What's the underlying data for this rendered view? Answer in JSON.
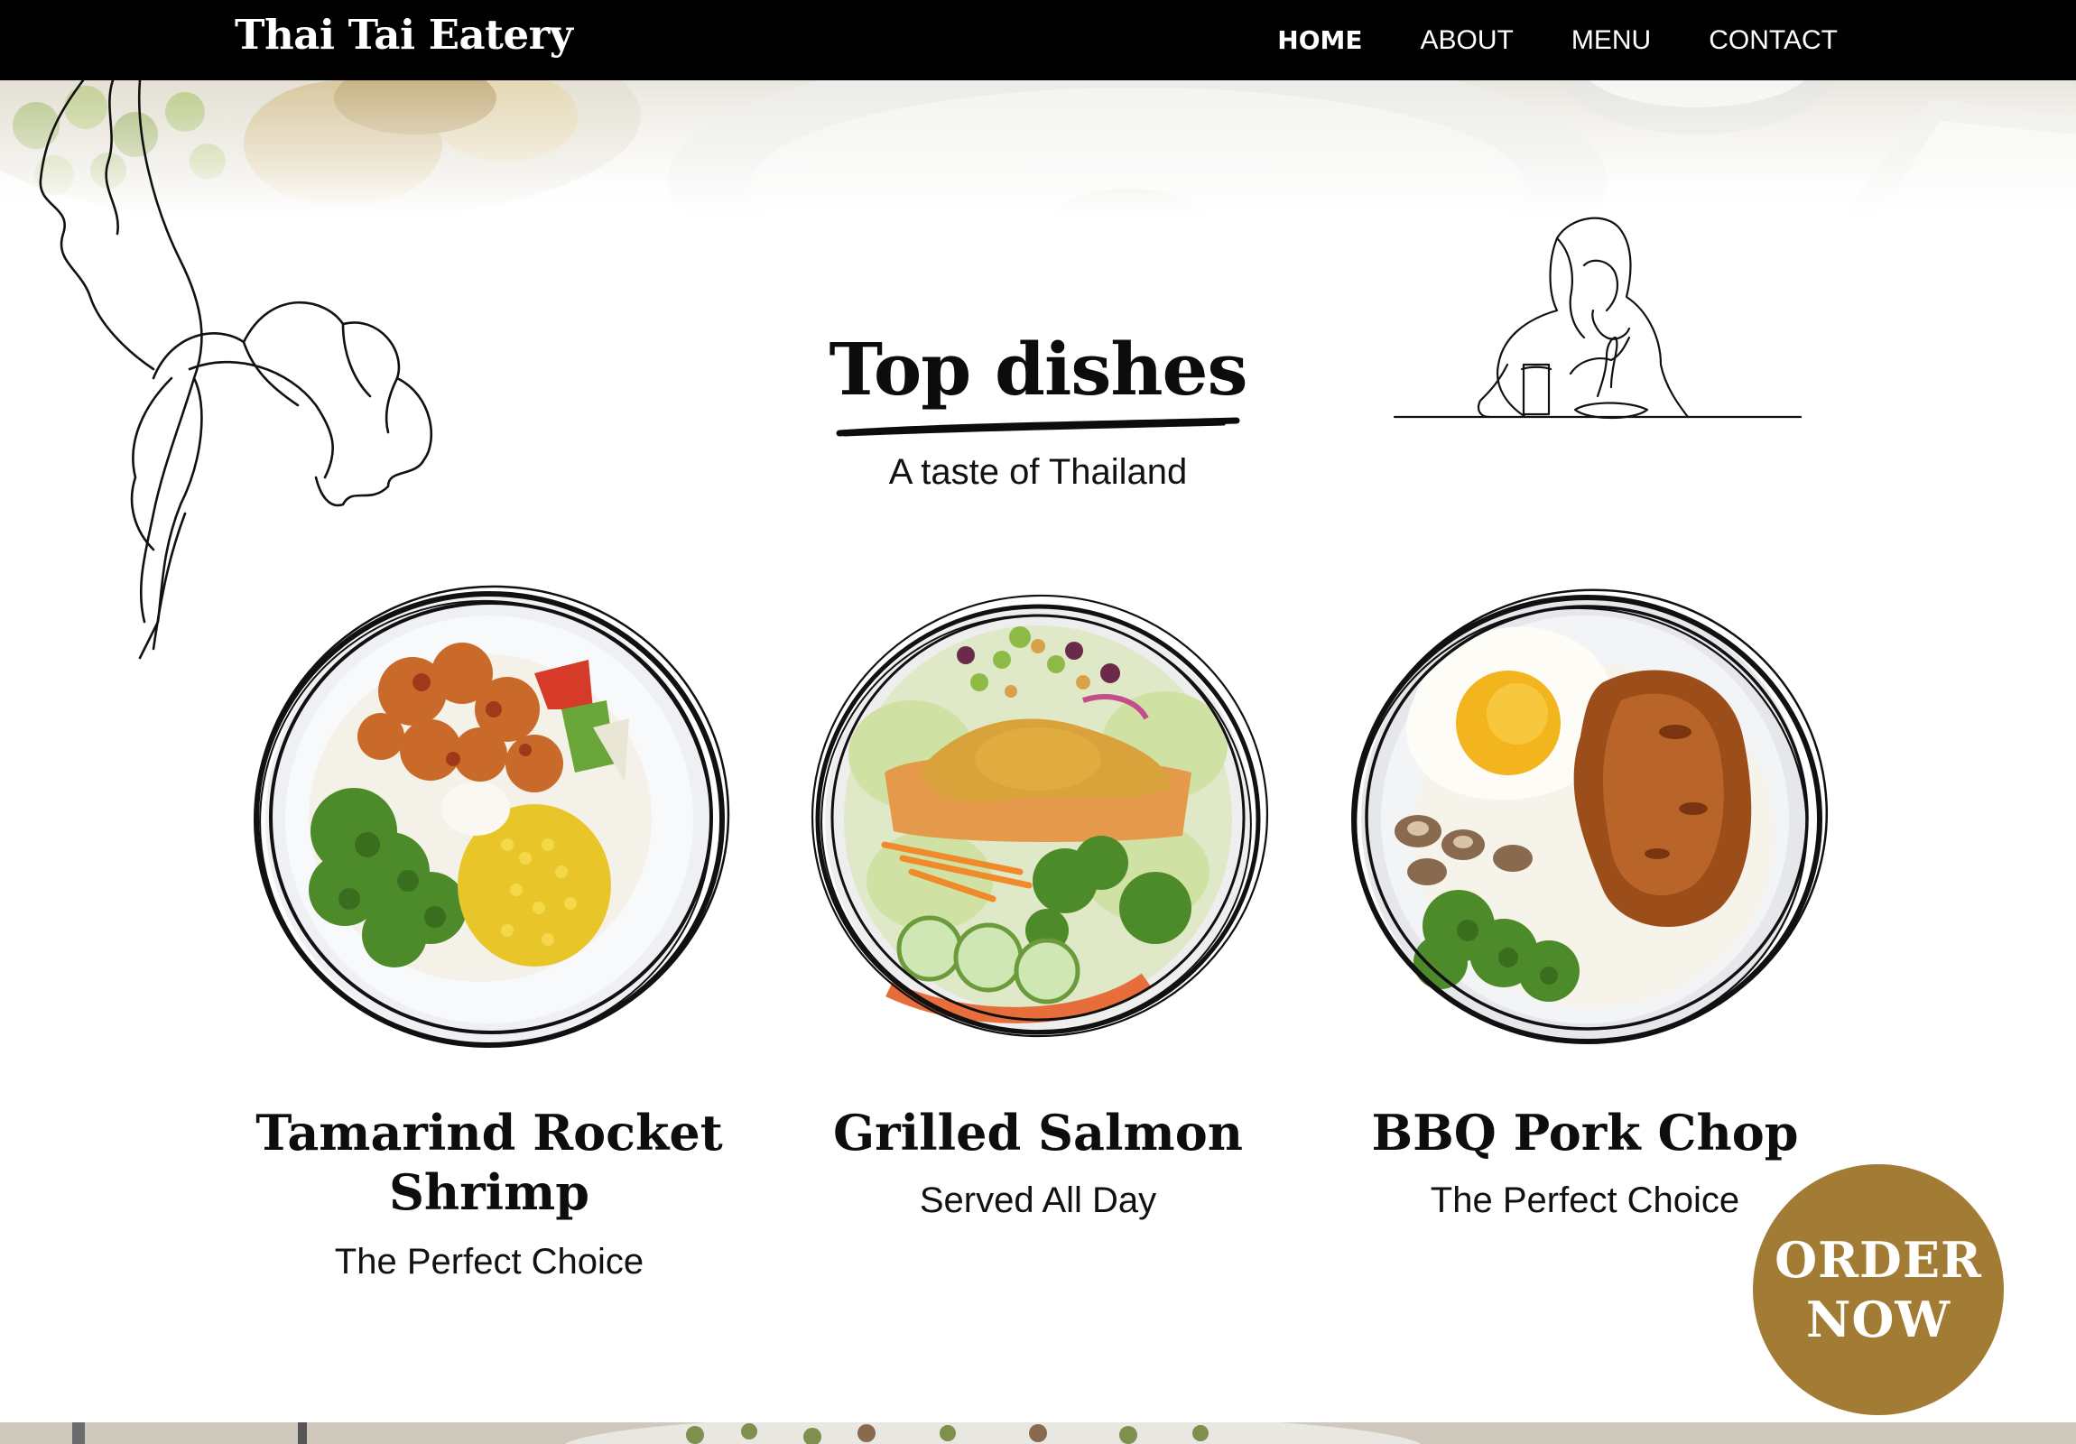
{
  "nav": {
    "brand": "Thai Tai Eatery",
    "links": [
      {
        "label": "HOME",
        "active": true
      },
      {
        "label": "ABOUT",
        "active": false
      },
      {
        "label": "MENU",
        "active": false
      },
      {
        "label": "CONTACT",
        "active": false
      }
    ]
  },
  "section": {
    "title": "Top dishes",
    "subtitle": "A taste of Thailand"
  },
  "dishes": [
    {
      "name": "Tamarind Rocket Shrimp",
      "desc": "The Perfect Choice",
      "image": "shrimp-rice-bowl"
    },
    {
      "name": "Grilled Salmon",
      "desc": "Served All Day",
      "image": "salmon-salad-bowl"
    },
    {
      "name": "BBQ Pork Chop",
      "desc": "The Perfect Choice",
      "image": "pork-chop-egg-bowl"
    }
  ],
  "order_button": {
    "line1": "ORDER",
    "line2": "NOW"
  },
  "icons": [
    "leaf-line-art-icon",
    "woman-eating-line-art-icon",
    "title-underline-icon"
  ],
  "colors": {
    "nav_background": "#000000",
    "nav_text": "#ffffff",
    "accent_gold": "#a27c34",
    "heading_text": "#0c0c0c",
    "page_background": "#ffffff"
  }
}
